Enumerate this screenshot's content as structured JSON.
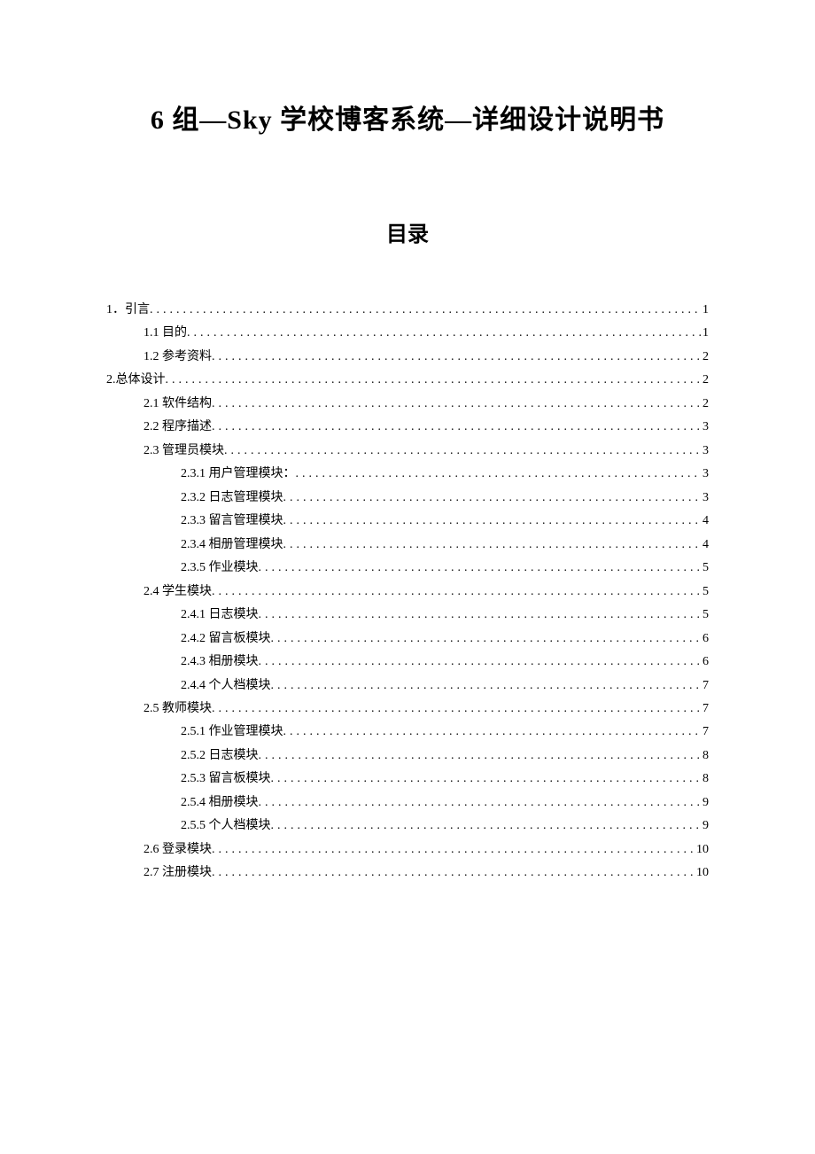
{
  "title": "6 组—Sky 学校博客系统—详细设计说明书",
  "toc_title": "目录",
  "toc": [
    {
      "label": "1．引言",
      "page": "1",
      "level": 0
    },
    {
      "label": "1.1 目的",
      "page": "1",
      "level": 1
    },
    {
      "label": "1.2 参考资料",
      "page": "2",
      "level": 1
    },
    {
      "label": "2.总体设计",
      "page": "2",
      "level": 0
    },
    {
      "label": "2.1 软件结构",
      "page": "2",
      "level": 1
    },
    {
      "label": "2.2 程序描述",
      "page": "3",
      "level": 1
    },
    {
      "label": "2.3 管理员模块",
      "page": "3",
      "level": 1
    },
    {
      "label": "2.3.1 用户管理模块：",
      "page": "3",
      "level": 2
    },
    {
      "label": "2.3.2 日志管理模块",
      "page": "3",
      "level": 2
    },
    {
      "label": "2.3.3 留言管理模块",
      "page": "4",
      "level": 2
    },
    {
      "label": "2.3.4 相册管理模块",
      "page": "4",
      "level": 2
    },
    {
      "label": "2.3.5 作业模块",
      "page": "5",
      "level": 2
    },
    {
      "label": "2.4 学生模块",
      "page": "5",
      "level": 1
    },
    {
      "label": "2.4.1 日志模块",
      "page": "5",
      "level": 2
    },
    {
      "label": "2.4.2 留言板模块",
      "page": "6",
      "level": 2
    },
    {
      "label": "2.4.3 相册模块",
      "page": "6",
      "level": 2
    },
    {
      "label": "2.4.4 个人档模块",
      "page": "7",
      "level": 2
    },
    {
      "label": "2.5 教师模块",
      "page": "7",
      "level": 1
    },
    {
      "label": "2.5.1 作业管理模块",
      "page": "7",
      "level": 2
    },
    {
      "label": "2.5.2 日志模块",
      "page": "8",
      "level": 2
    },
    {
      "label": "2.5.3 留言板模块",
      "page": "8",
      "level": 2
    },
    {
      "label": "2.5.4 相册模块",
      "page": "9",
      "level": 2
    },
    {
      "label": "2.5.5 个人档模块",
      "page": "9",
      "level": 2
    },
    {
      "label": "2.6 登录模块",
      "page": "10",
      "level": 1
    },
    {
      "label": "2.7 注册模块",
      "page": "10",
      "level": 1
    }
  ]
}
